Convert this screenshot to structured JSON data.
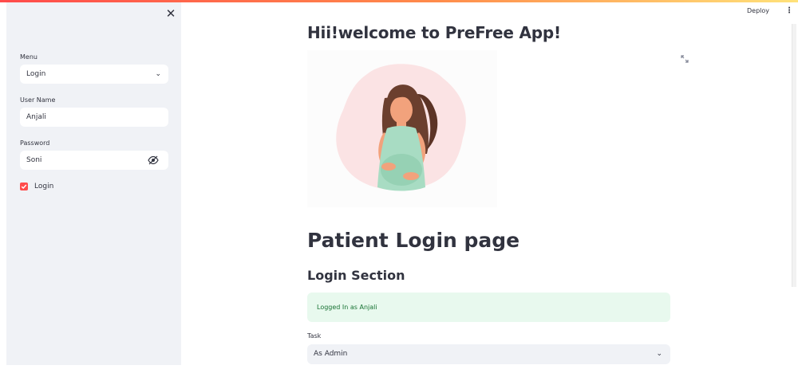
{
  "header": {
    "deploy_label": "Deploy",
    "menu_icon": "kebab-menu-icon"
  },
  "sidebar": {
    "close_icon": "close-icon",
    "menu": {
      "label": "Menu",
      "selected": "Login"
    },
    "username": {
      "label": "User Name",
      "value": "Anjali"
    },
    "password": {
      "label": "Password",
      "value": "Soni"
    },
    "login_checkbox": {
      "label": "Login",
      "checked": true
    }
  },
  "main": {
    "welcome_title": "Hii!welcome to PreFree App!",
    "page_title": "Patient Login page",
    "section_title": "Login Section",
    "success_message": "Logged In as Anjali",
    "task": {
      "label": "Task",
      "selected": "As Admin"
    }
  },
  "colors": {
    "accent": "#ff4b4b",
    "sidebar_bg": "#f0f2f6",
    "success_bg": "#e8f9ee",
    "success_text": "#177233"
  }
}
